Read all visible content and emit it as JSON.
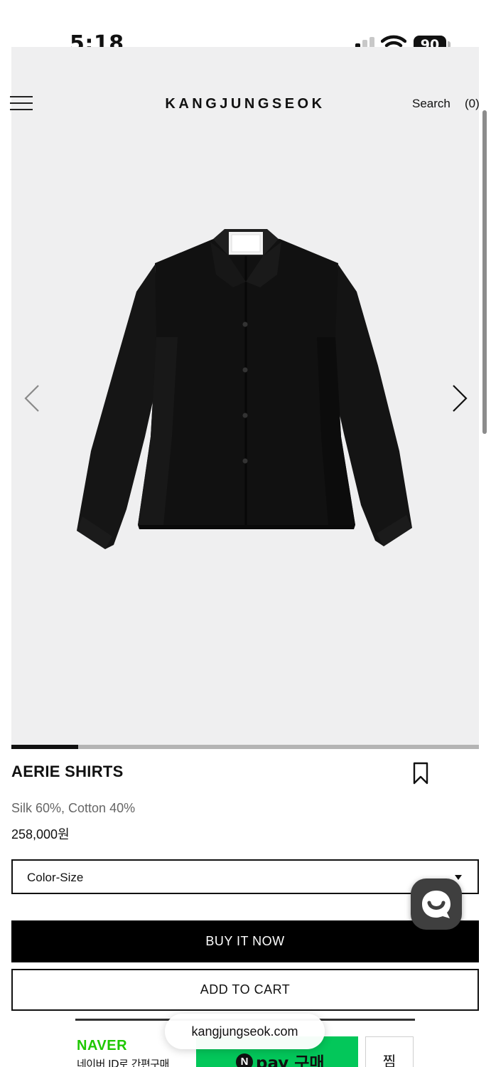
{
  "status_bar": {
    "time": "5:18",
    "battery": "90",
    "icons": [
      "cellular-signal-icon",
      "wifi-icon",
      "battery-icon"
    ]
  },
  "header": {
    "logo": "KANGJUNGSEOK",
    "search_label": "Search",
    "cart_count": "(0)",
    "menu_icon": "hamburger-menu-icon"
  },
  "gallery": {
    "image": "black long-sleeve shirt",
    "prev_icon": "chevron-left-icon",
    "next_icon": "chevron-right-icon",
    "slide_progress": 0.143,
    "background": "#efeff0"
  },
  "product": {
    "name": "AERIE SHIRTS",
    "material": "Silk 60%, Cotton 40%",
    "price": "258,000원",
    "bookmark_icon": "bookmark-icon"
  },
  "options": {
    "selected": "Color-Size"
  },
  "actions": {
    "buy_label": "BUY IT NOW",
    "cart_label": "ADD TO CART",
    "chat_icon": "chat-bubble-icon"
  },
  "naver_pay": {
    "brand": "NAVER",
    "subtitle": "네이버 ID로 간편구매",
    "button_n": "N",
    "button_label": "pay 구매",
    "wish_label": "찜",
    "accent_color": "#03c75a"
  },
  "browser": {
    "url": "kangjungseok.com"
  }
}
